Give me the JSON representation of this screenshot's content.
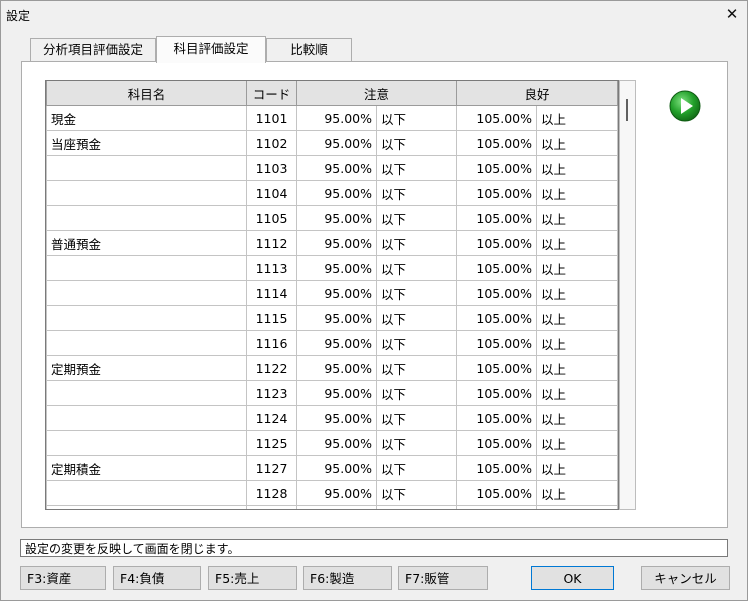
{
  "window": {
    "title": "設定",
    "close_glyph": "✕"
  },
  "tabs": [
    {
      "label": "分析項目評価設定"
    },
    {
      "label": "科目評価設定"
    },
    {
      "label": "比較順"
    }
  ],
  "grid": {
    "headers": {
      "name": "科目名",
      "code": "コード",
      "caution": "注意",
      "good": "良好"
    },
    "rows": [
      {
        "name": "現金",
        "code": "1101",
        "caution_value": "95.00%",
        "caution_unit": "以下",
        "good_value": "105.00%",
        "good_unit": "以上"
      },
      {
        "name": "当座預金",
        "code": "1102",
        "caution_value": "95.00%",
        "caution_unit": "以下",
        "good_value": "105.00%",
        "good_unit": "以上"
      },
      {
        "name": "",
        "code": "1103",
        "caution_value": "95.00%",
        "caution_unit": "以下",
        "good_value": "105.00%",
        "good_unit": "以上"
      },
      {
        "name": "",
        "code": "1104",
        "caution_value": "95.00%",
        "caution_unit": "以下",
        "good_value": "105.00%",
        "good_unit": "以上"
      },
      {
        "name": "",
        "code": "1105",
        "caution_value": "95.00%",
        "caution_unit": "以下",
        "good_value": "105.00%",
        "good_unit": "以上"
      },
      {
        "name": "普通預金",
        "code": "1112",
        "caution_value": "95.00%",
        "caution_unit": "以下",
        "good_value": "105.00%",
        "good_unit": "以上"
      },
      {
        "name": "",
        "code": "1113",
        "caution_value": "95.00%",
        "caution_unit": "以下",
        "good_value": "105.00%",
        "good_unit": "以上"
      },
      {
        "name": "",
        "code": "1114",
        "caution_value": "95.00%",
        "caution_unit": "以下",
        "good_value": "105.00%",
        "good_unit": "以上"
      },
      {
        "name": "",
        "code": "1115",
        "caution_value": "95.00%",
        "caution_unit": "以下",
        "good_value": "105.00%",
        "good_unit": "以上"
      },
      {
        "name": "",
        "code": "1116",
        "caution_value": "95.00%",
        "caution_unit": "以下",
        "good_value": "105.00%",
        "good_unit": "以上"
      },
      {
        "name": "定期預金",
        "code": "1122",
        "caution_value": "95.00%",
        "caution_unit": "以下",
        "good_value": "105.00%",
        "good_unit": "以上"
      },
      {
        "name": "",
        "code": "1123",
        "caution_value": "95.00%",
        "caution_unit": "以下",
        "good_value": "105.00%",
        "good_unit": "以上"
      },
      {
        "name": "",
        "code": "1124",
        "caution_value": "95.00%",
        "caution_unit": "以下",
        "good_value": "105.00%",
        "good_unit": "以上"
      },
      {
        "name": "",
        "code": "1125",
        "caution_value": "95.00%",
        "caution_unit": "以下",
        "good_value": "105.00%",
        "good_unit": "以上"
      },
      {
        "name": "定期積金",
        "code": "1127",
        "caution_value": "95.00%",
        "caution_unit": "以下",
        "good_value": "105.00%",
        "good_unit": "以上"
      },
      {
        "name": "",
        "code": "1128",
        "caution_value": "95.00%",
        "caution_unit": "以下",
        "good_value": "105.00%",
        "good_unit": "以上"
      },
      {
        "name": "",
        "code": "",
        "caution_value": "",
        "caution_unit": "",
        "good_value": "",
        "good_unit": ""
      }
    ]
  },
  "play_button": {
    "icon": "play-circle-icon",
    "color": "#22a02a"
  },
  "status": {
    "text": "設定の変更を反映して画面を閉じます。"
  },
  "buttons": {
    "f3": "F3:資産",
    "f4": "F4:負債",
    "f5": "F5:売上",
    "f6": "F6:製造",
    "f7": "F7:販管",
    "ok": "OK",
    "cancel": "キャンセル"
  }
}
